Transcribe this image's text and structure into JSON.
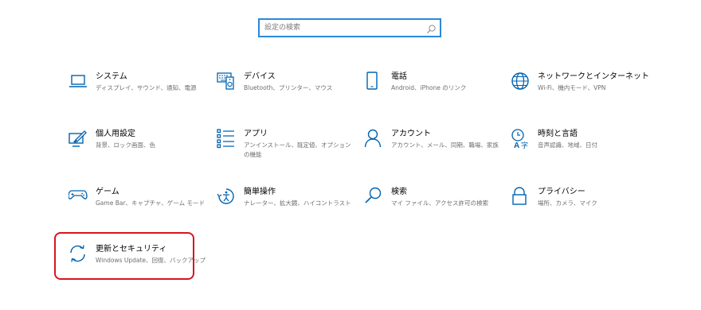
{
  "search": {
    "placeholder": "設定の検索"
  },
  "tiles": [
    {
      "title": "システム",
      "desc": "ディスプレイ、サウンド、通知、電源",
      "icon": "laptop-icon"
    },
    {
      "title": "デバイス",
      "desc": "Bluetooth、プリンター、マウス",
      "icon": "keyboard-speaker-icon"
    },
    {
      "title": "電話",
      "desc": "Android、iPhone のリンク",
      "icon": "phone-icon"
    },
    {
      "title": "ネットワークとインターネット",
      "desc": "Wi-Fi、機内モード、VPN",
      "icon": "globe-icon"
    },
    {
      "title": "個人用設定",
      "desc": "背景、ロック画面、色",
      "icon": "paint-monitor-icon"
    },
    {
      "title": "アプリ",
      "desc": "アンインストール、既定値、オプションの機能",
      "icon": "app-list-icon"
    },
    {
      "title": "アカウント",
      "desc": "アカウント、メール、同期、職場、家族",
      "icon": "person-icon"
    },
    {
      "title": "時刻と言語",
      "desc": "音声認識、地域、日付",
      "icon": "time-language-icon"
    },
    {
      "title": "ゲーム",
      "desc": "Game Bar、キャプチャ、ゲーム モード",
      "icon": "gamepad-icon"
    },
    {
      "title": "簡単操作",
      "desc": "ナレーター、拡大鏡、ハイコントラスト",
      "icon": "ease-of-access-icon"
    },
    {
      "title": "検索",
      "desc": "マイ ファイル、アクセス許可の検索",
      "icon": "magnifier-icon"
    },
    {
      "title": "プライバシー",
      "desc": "場所、カメラ、マイク",
      "icon": "lock-icon"
    },
    {
      "title": "更新とセキュリティ",
      "desc": "Windows Update、回復、バックアップ",
      "icon": "sync-arrows-icon"
    }
  ],
  "colors": {
    "accent": "#0063b1",
    "highlight": "#d9141e",
    "search_border": "#2b88d8"
  }
}
